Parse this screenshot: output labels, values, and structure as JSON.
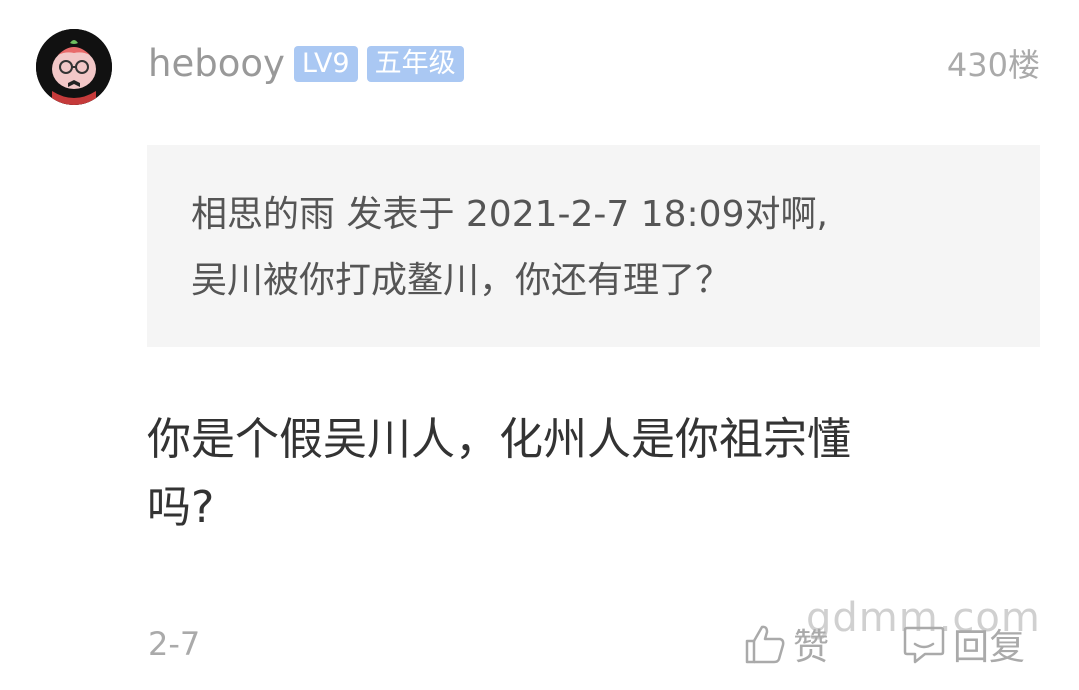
{
  "post": {
    "username": "hebooy",
    "level_badge": "LV9",
    "grade_badge": "五年级",
    "floor": "430楼",
    "quote": {
      "line1": "相思的雨 发表于 2021-2-7 18:09对啊,",
      "line2": "吴川被你打成鳌川，你还有理了？"
    },
    "content": {
      "line1": "你是个假吴川人，化州人是你祖宗懂",
      "line2": "吗?"
    },
    "date": "2-7",
    "like_label": "赞",
    "reply_label": "回复"
  },
  "watermark": "gdmm.com",
  "colors": {
    "badge": "#aac8f3",
    "muted": "#aaaaaa",
    "quote_bg": "#f5f5f5"
  },
  "icons": {
    "avatar": "avatar-image",
    "like": "thumbs-up-icon",
    "reply": "comment-icon"
  }
}
